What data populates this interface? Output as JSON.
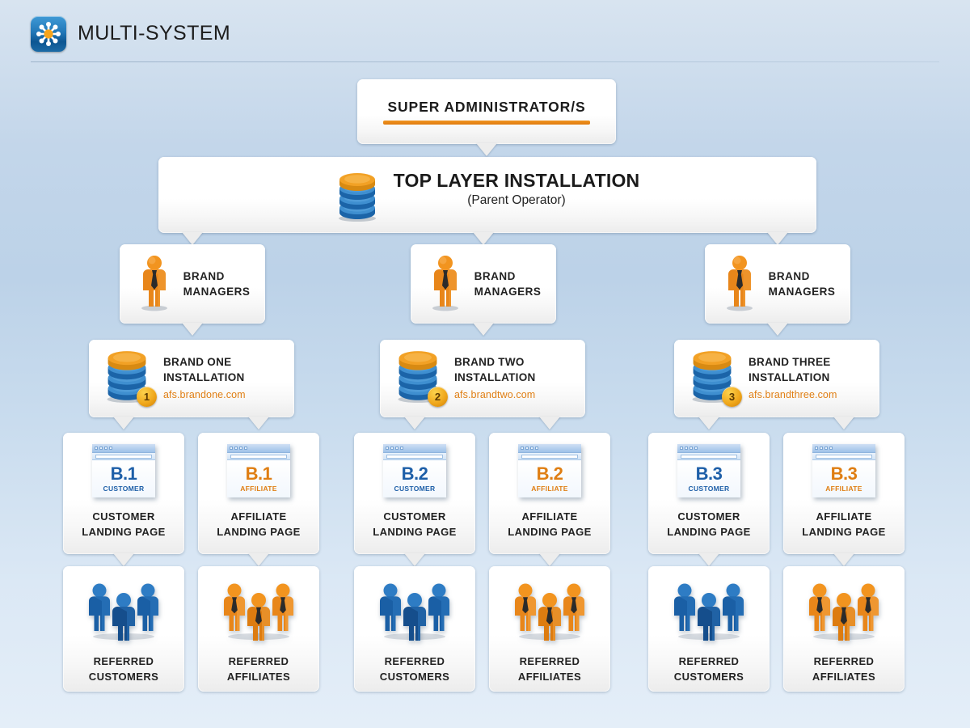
{
  "header": {
    "title": "MULTI-SYSTEM",
    "icon": "hub-spoke-icon"
  },
  "diagram": {
    "super_admin": {
      "label": "SUPER ADMINISTRATOR/S",
      "accent_color": "#e8860f"
    },
    "top_layer": {
      "title": "TOP LAYER INSTALLATION",
      "subtitle": "(Parent Operator)",
      "icon": "database-icon"
    },
    "brand_managers": [
      {
        "line1": "BRAND",
        "line2": "MANAGERS",
        "icon": "person-manager-icon"
      },
      {
        "line1": "BRAND",
        "line2": "MANAGERS",
        "icon": "person-manager-icon"
      },
      {
        "line1": "BRAND",
        "line2": "MANAGERS",
        "icon": "person-manager-icon"
      }
    ],
    "brand_installations": [
      {
        "line1": "BRAND ONE",
        "line2": "INSTALLATION",
        "url": "afs.brandone.com",
        "badge": "1",
        "icon": "database-icon"
      },
      {
        "line1": "BRAND TWO",
        "line2": "INSTALLATION",
        "url": "afs.brandtwo.com",
        "badge": "2",
        "icon": "database-icon"
      },
      {
        "line1": "BRAND THREE",
        "line2": "INSTALLATION",
        "url": "afs.brandthree.com",
        "badge": "3",
        "icon": "database-icon"
      }
    ],
    "landing_pages": [
      {
        "badge_big": "B.1",
        "badge_small": "CUSTOMER",
        "line1": "CUSTOMER",
        "line2": "LANDING PAGE",
        "tone": "customer",
        "icon": "browser-window-icon"
      },
      {
        "badge_big": "B.1",
        "badge_small": "AFFILIATE",
        "line1": "AFFILIATE",
        "line2": "LANDING PAGE",
        "tone": "affiliate",
        "icon": "browser-window-icon"
      },
      {
        "badge_big": "B.2",
        "badge_small": "CUSTOMER",
        "line1": "CUSTOMER",
        "line2": "LANDING PAGE",
        "tone": "customer",
        "icon": "browser-window-icon"
      },
      {
        "badge_big": "B.2",
        "badge_small": "AFFILIATE",
        "line1": "AFFILIATE",
        "line2": "LANDING PAGE",
        "tone": "affiliate",
        "icon": "browser-window-icon"
      },
      {
        "badge_big": "B.3",
        "badge_small": "CUSTOMER",
        "line1": "CUSTOMER",
        "line2": "LANDING PAGE",
        "tone": "customer",
        "icon": "browser-window-icon"
      },
      {
        "badge_big": "B.3",
        "badge_small": "AFFILIATE",
        "line1": "AFFILIATE",
        "line2": "LANDING PAGE",
        "tone": "affiliate",
        "icon": "browser-window-icon"
      }
    ],
    "referred": [
      {
        "line1": "REFERRED",
        "line2": "CUSTOMERS",
        "tone": "customer",
        "icon": "people-group-icon"
      },
      {
        "line1": "REFERRED",
        "line2": "AFFILIATES",
        "tone": "affiliate",
        "icon": "people-group-icon"
      },
      {
        "line1": "REFERRED",
        "line2": "CUSTOMERS",
        "tone": "customer",
        "icon": "people-group-icon"
      },
      {
        "line1": "REFERRED",
        "line2": "AFFILIATES",
        "tone": "affiliate",
        "icon": "people-group-icon"
      },
      {
        "line1": "REFERRED",
        "line2": "CUSTOMERS",
        "tone": "customer",
        "icon": "people-group-icon"
      },
      {
        "line1": "REFERRED",
        "line2": "AFFILIATES",
        "tone": "affiliate",
        "icon": "people-group-icon"
      }
    ]
  },
  "colors": {
    "orange": "#e07f14",
    "blue": "#1e5fa8",
    "text": "#222222",
    "background_top": "#d8e4f0",
    "background_bottom": "#e4eef8"
  }
}
